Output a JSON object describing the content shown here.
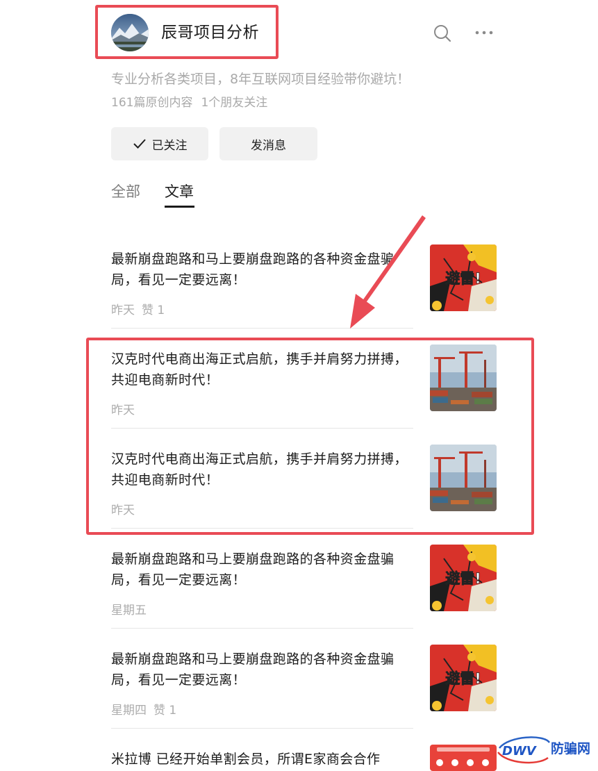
{
  "account": {
    "name": "辰哥项目分析",
    "description": "专业分析各类项目，8年互联网项目经验带你避坑！",
    "stats": [
      "161篇原创内容",
      "1个朋友关注"
    ]
  },
  "actions": {
    "follow_label": "已关注",
    "message_label": "发消息"
  },
  "tabs": [
    {
      "label": "全部",
      "active": false
    },
    {
      "label": "文章",
      "active": true
    }
  ],
  "articles": [
    {
      "title": "最新崩盘跑路和马上要崩盘跑路的各种资金盘骗局，看见一定要远离！",
      "date": "昨天",
      "likes": "赞 1",
      "thumb": "warning-thumbnail",
      "thumb_text": "避雷!"
    },
    {
      "title": "汉克时代电商出海正式启航，携手并肩努力拼搏，共迎电商新时代！",
      "date": "昨天",
      "likes": "",
      "thumb": "port-cranes-thumbnail"
    },
    {
      "title": "汉克时代电商出海正式启航，携手并肩努力拼搏，共迎电商新时代！",
      "date": "昨天",
      "likes": "",
      "thumb": "port-cranes-thumbnail"
    },
    {
      "title": "最新崩盘跑路和马上要崩盘跑路的各种资金盘骗局，看见一定要远离！",
      "date": "星期五",
      "likes": "",
      "thumb": "warning-thumbnail",
      "thumb_text": "避雷!"
    },
    {
      "title": "最新崩盘跑路和马上要崩盘跑路的各种资金盘骗局，看见一定要远离！",
      "date": "星期四",
      "likes": "赞 1",
      "thumb": "warning-thumbnail",
      "thumb_text": "避雷!"
    },
    {
      "title": "米拉博 已经开始单割会员，所谓E家商会合作",
      "date": "",
      "likes": "",
      "thumb": "red-promo-thumbnail"
    }
  ],
  "watermark": {
    "text": "DWV",
    "label": "防骗网"
  },
  "colors": {
    "highlight": "#e94b55",
    "muted": "#a9a9a9",
    "button_bg": "#f1f1f1"
  }
}
